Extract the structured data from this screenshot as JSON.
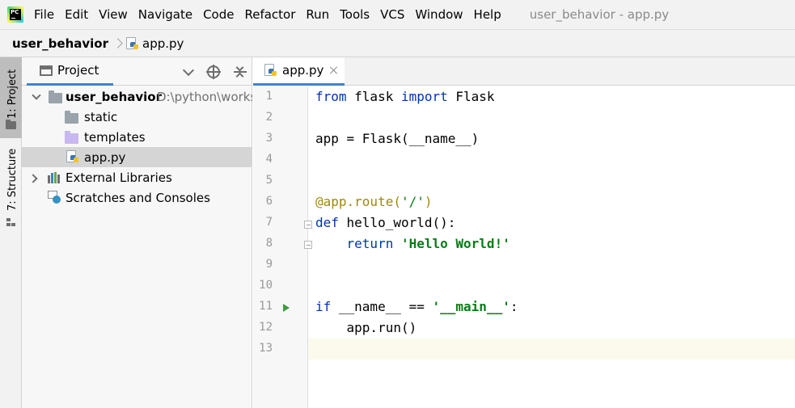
{
  "menubar": {
    "logo_text": "PC",
    "items": [
      "File",
      "Edit",
      "View",
      "Navigate",
      "Code",
      "Refactor",
      "Run",
      "Tools",
      "VCS",
      "Window",
      "Help"
    ],
    "window_title": "user_behavior - app.py"
  },
  "breadcrumb": {
    "project": "user_behavior",
    "file": "app.py"
  },
  "toolstrip": {
    "project_label": "1: Project",
    "structure_label": "7: Structure"
  },
  "project_panel": {
    "tab_label": "Project",
    "tree": {
      "root_name": "user_behavior",
      "root_path": "D:\\python\\works",
      "children": [
        "static",
        "templates",
        "app.py"
      ],
      "external_libraries": "External Libraries",
      "scratches": "Scratches and Consoles"
    }
  },
  "editor": {
    "tab_label": "app.py",
    "line_numbers": [
      "1",
      "2",
      "3",
      "4",
      "5",
      "6",
      "7",
      "8",
      "9",
      "10",
      "11",
      "12",
      "13"
    ],
    "current_line": 13,
    "code": {
      "l1_kw1": "from",
      "l1_mod": " flask ",
      "l1_kw2": "import",
      "l1_name": " Flask",
      "l3": "app = Flask(__name__)",
      "l6_deco": "@app.route(",
      "l6_str": "'/'",
      "l6_end": ")",
      "l7_kw": "def",
      "l7_rest": " hello_world():",
      "l8_indent": "    ",
      "l8_kw": "return",
      "l8_sp": " ",
      "l8_str": "'Hello World!'",
      "l11_kw": "if",
      "l11_mid": " __name__ == ",
      "l11_str": "'__main__'",
      "l11_end": ":",
      "l12": "    app.run()"
    }
  },
  "colors": {
    "keyword": "#0033b3",
    "string": "#067d17",
    "decorator": "#9e880d",
    "accent": "#4083c9",
    "run_marker": "#3c9e3c"
  }
}
